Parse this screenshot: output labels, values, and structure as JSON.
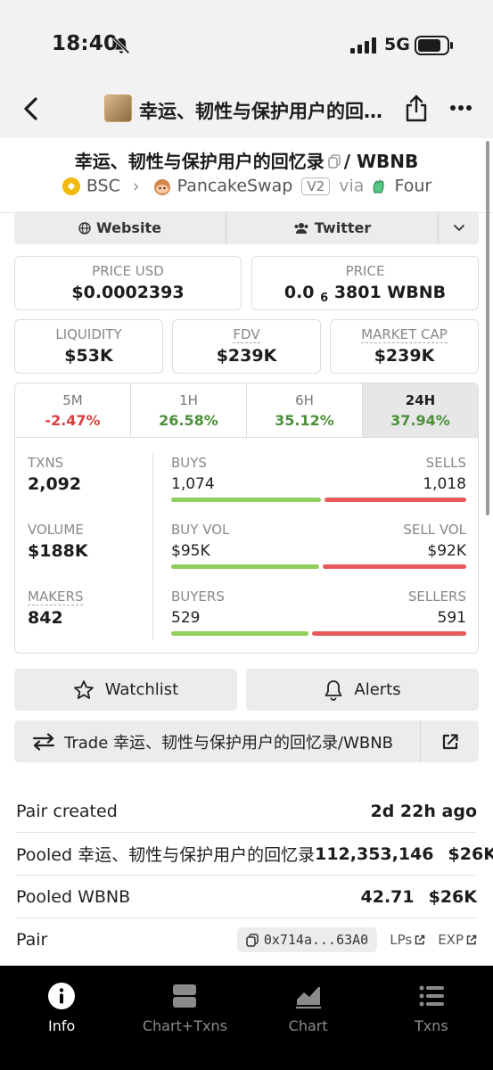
{
  "status_bar": {
    "time": "18:40",
    "network": "5G"
  },
  "nav": {
    "title": "幸运、韧性与保护用户的回忆录"
  },
  "pair": {
    "title": "幸运、韧性与保护用户的回忆录",
    "quote": "/ WBNB",
    "chain": "BSC",
    "dex": "PancakeSwap",
    "version": "V2",
    "via": "via",
    "launchpad": "Four"
  },
  "links": {
    "website": "Website",
    "twitter": "Twitter"
  },
  "prices": {
    "price_usd_label": "PRICE USD",
    "price_usd": "$0.0002393",
    "price_label": "PRICE",
    "price_prefix": "0.0",
    "price_zeros": "6",
    "price_rest": "3801 WBNB",
    "liquidity_label": "LIQUIDITY",
    "liquidity": "$53K",
    "fdv_label": "FDV",
    "fdv": "$239K",
    "mcap_label": "MARKET CAP",
    "mcap": "$239K"
  },
  "timeframes": [
    {
      "label": "5M",
      "value": "-2.47%"
    },
    {
      "label": "1H",
      "value": "26.58%"
    },
    {
      "label": "6H",
      "value": "35.12%"
    },
    {
      "label": "24H",
      "value": "37.94%"
    }
  ],
  "stats": {
    "txns_label": "TXNS",
    "txns": "2,092",
    "volume_label": "VOLUME",
    "volume": "$188K",
    "makers_label": "MAKERS",
    "makers": "842",
    "buys_label": "BUYS",
    "buys": "1,074",
    "sells_label": "SELLS",
    "sells": "1,018",
    "buy_vol_label": "BUY VOL",
    "buy_vol": "$95K",
    "sell_vol_label": "SELL VOL",
    "sell_vol": "$92K",
    "buyers_label": "BUYERS",
    "buyers": "529",
    "sellers_label": "SELLERS",
    "sellers": "591",
    "buys_ratio": 0.513,
    "buy_vol_ratio": 0.508,
    "buyers_ratio": 0.472
  },
  "actions": {
    "watchlist": "Watchlist",
    "alerts": "Alerts",
    "trade": "Trade 幸运、韧性与保护用户的回忆录/WBNB"
  },
  "info": {
    "pair_created_label": "Pair created",
    "pair_created": "2d 22h ago",
    "pooled_token_label": "Pooled 幸运、韧性与保护用户的回忆录",
    "pooled_token_amount": "112,353,146",
    "pooled_token_usd": "$26K",
    "pooled_wbnb_label": "Pooled WBNB",
    "pooled_wbnb_amount": "42.71",
    "pooled_wbnb_usd": "$26K",
    "pair_label": "Pair",
    "pair_address": "0x714a...63A0",
    "lps": "LPs",
    "exp": "EXP"
  },
  "tabs": [
    {
      "label": "Info"
    },
    {
      "label": "Chart+Txns"
    },
    {
      "label": "Chart"
    },
    {
      "label": "Txns"
    }
  ],
  "colors": {
    "negative": "#d94040",
    "positive": "#4b8f39",
    "buy_bar": "#8fcf5c",
    "sell_bar": "#e85a5a"
  }
}
